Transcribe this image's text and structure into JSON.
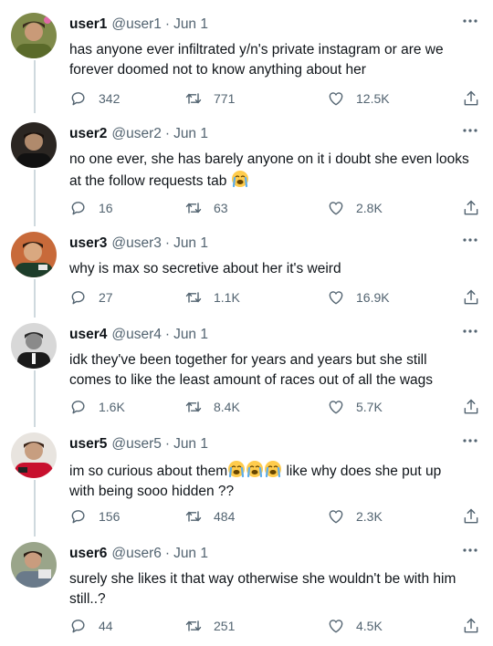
{
  "tweets": [
    {
      "name": "user1",
      "handle": "@user1",
      "dot": "·",
      "date": "Jun 1",
      "text": [
        "has anyone ever infiltrated y/n's private instagram or are we",
        "forever doomed not to know anything about her"
      ],
      "emoji_count": 0,
      "replies": "342",
      "retweets": "771",
      "likes": "12.5K"
    },
    {
      "name": "user2",
      "handle": "@user2",
      "dot": "·",
      "date": "Jun 1",
      "text": [
        "no one ever, she has barely anyone on it i doubt she even looks",
        "at the follow requests tab"
      ],
      "emoji_count": 1,
      "replies": "16",
      "retweets": "63",
      "likes": "2.8K"
    },
    {
      "name": "user3",
      "handle": "@user3",
      "dot": "·",
      "date": "Jun 1",
      "text": [
        "why is max so secretive about her it's weird"
      ],
      "emoji_count": 0,
      "replies": "27",
      "retweets": "1.1K",
      "likes": "16.9K"
    },
    {
      "name": "user4",
      "handle": "@user4",
      "dot": "·",
      "date": "Jun 1",
      "text": [
        "idk they've been together for years and years but she still",
        "comes to like the least amount of races out of all the wags"
      ],
      "emoji_count": 0,
      "replies": "1.6K",
      "retweets": "8.4K",
      "likes": "5.7K"
    },
    {
      "name": "user5",
      "handle": "@user5",
      "dot": "·",
      "date": "Jun 1",
      "text": [
        "im so curious about them",
        " like why does she put up",
        "with being sooo hidden ??"
      ],
      "emoji_count": 3,
      "replies": "156",
      "retweets": "484",
      "likes": "2.3K"
    },
    {
      "name": "user6",
      "handle": "@user6",
      "dot": "·",
      "date": "Jun 1",
      "text": [
        "surely she likes it that way otherwise she wouldn't be with him",
        "still..?"
      ],
      "emoji_count": 0,
      "replies": "44",
      "retweets": "251",
      "likes": "4.5K"
    }
  ],
  "icons": {
    "more": "more-icon",
    "reply": "reply-icon",
    "retweet": "retweet-icon",
    "like": "like-icon",
    "share": "share-icon",
    "emoji": "loudly-crying-face-emoji"
  },
  "colors": {
    "text": "#0f1419",
    "secondary": "#536471",
    "thread_line": "#cfd9de"
  }
}
